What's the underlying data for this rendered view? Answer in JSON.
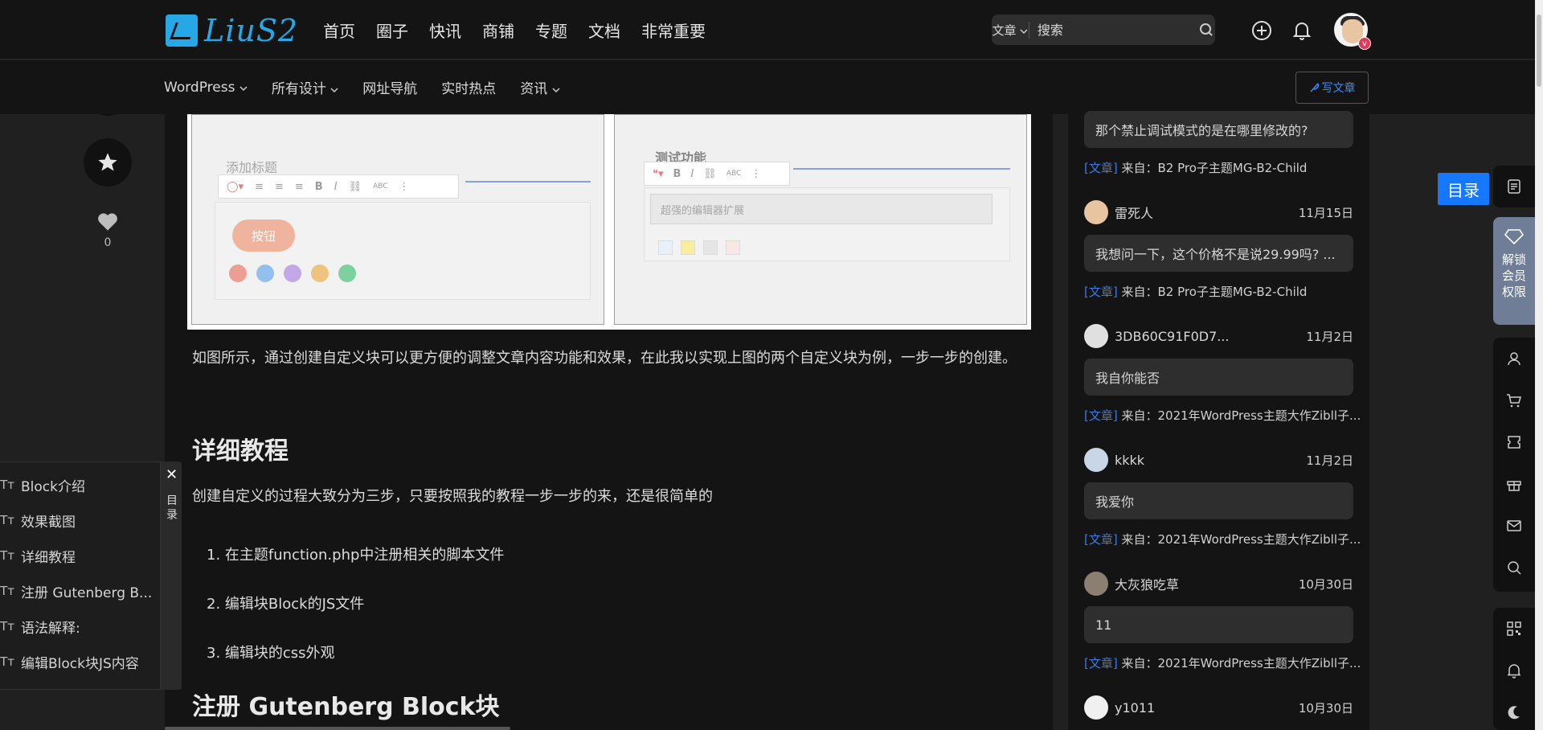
{
  "site": {
    "logo_text": "LiuS2"
  },
  "main_nav": [
    "首页",
    "圈子",
    "快讯",
    "商铺",
    "专题",
    "文档",
    "非常重要"
  ],
  "search": {
    "category": "文章",
    "placeholder": "搜索"
  },
  "sub_nav": [
    "WordPress",
    "所有设计",
    "网址导航",
    "实时热点",
    "资讯"
  ],
  "write_button": "写文章",
  "like_count": "0",
  "article": {
    "screenshot_a": {
      "title": "添加标题",
      "button": "按钮"
    },
    "screenshot_b": {
      "title": "测试功能",
      "input": "超强的编辑器扩展"
    },
    "paragraph_1": "如图所示，通过创建自定义块可以更方便的调整文章内容功能和效果，在此我以实现上图的两个自定义块为例，一步一步的创建。",
    "heading_1": "详细教程",
    "paragraph_2": "创建自定义的过程大致分为三步，只要按照我的教程一步一步的来，还是很简单的",
    "steps": [
      "1. 在主题function.php中注册相关的脚本文件",
      "2. 编辑块Block的JS文件",
      "3. 编辑块的css外观"
    ],
    "heading_2": "注册 Gutenberg Block块"
  },
  "toc": {
    "close": "✕",
    "label": "目录",
    "items": [
      "Block介绍",
      "效果截图",
      "详细教程",
      "注册 Gutenberg B...",
      "语法解释:",
      "编辑Block块JS内容"
    ]
  },
  "comments": [
    {
      "text": "那个禁止调试模式的是在哪里修改的?",
      "tag": "[文章]",
      "source": "来自：B2 Pro子主题MG-B2-Child"
    },
    {
      "user": "雷死人",
      "date": "11月15日",
      "text": "我想问一下，这个价格不是说29.99吗? ...",
      "tag": "[文章]",
      "source": "来自：B2 Pro子主题MG-B2-Child"
    },
    {
      "user": "3DB60C91F0D7...",
      "date": "11月2日",
      "text": "我自你能否",
      "tag": "[文章]",
      "source": "来自：2021年WordPress主题大作Zibll子..."
    },
    {
      "user": "kkkk",
      "date": "11月2日",
      "text": "我爱你",
      "tag": "[文章]",
      "source": "来自：2021年WordPress主题大作Zibll子..."
    },
    {
      "user": "大灰狼吃草",
      "date": "10月30日",
      "text": "11",
      "tag": "[文章]",
      "source": "来自：2021年WordPress主题大作Zibll子..."
    },
    {
      "user": "y1011",
      "date": "10月30日"
    }
  ],
  "right_float": {
    "toc": "目录",
    "vip": "解锁会员权限"
  },
  "colors": {
    "accent": "#1677ff",
    "logo": "#27a8e6",
    "bg": "#202020",
    "panel": "#141414"
  }
}
